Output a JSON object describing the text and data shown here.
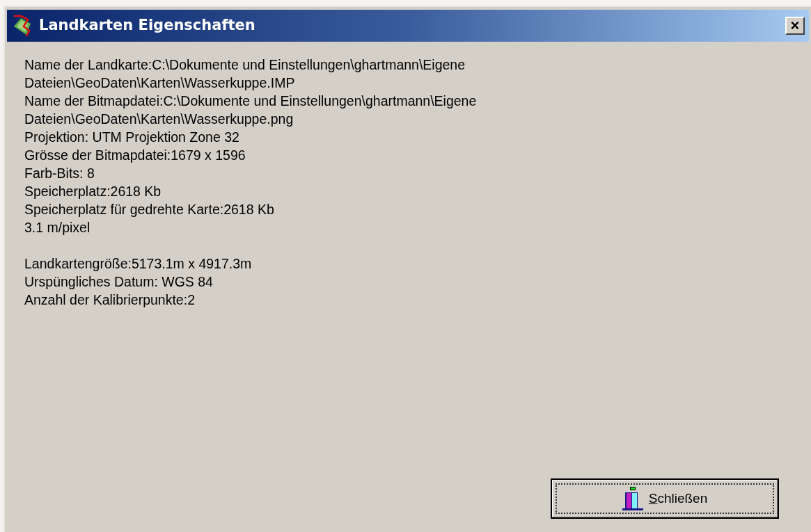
{
  "window": {
    "title": "Landkarten Eigenschaften",
    "close_label": "×"
  },
  "info_lines": [
    "Name der Landkarte:C:\\Dokumente und Einstellungen\\ghartmann\\Eigene",
    "Dateien\\GeoDaten\\Karten\\Wasserkuppe.IMP",
    "Name der Bitmapdatei:C:\\Dokumente und Einstellungen\\ghartmann\\Eigene",
    "Dateien\\GeoDaten\\Karten\\Wasserkuppe.png",
    "Projektion: UTM Projektion Zone 32",
    "Grösse der Bitmapdatei:1679 x 1596",
    "Farb-Bits: 8",
    "Speicherplatz:2618 Kb",
    "Speicherplatz für gedrehte Karte:2618 Kb",
    "3.1 m/pixel"
  ],
  "summary_lines": [
    "Landkartengröße:5173.1m x 4917.3m",
    "Urspüngliches Datum: WGS 84",
    "Anzahl der Kalibrierpunkte:2"
  ],
  "close_button": {
    "label": "Schließen",
    "focused": true
  }
}
